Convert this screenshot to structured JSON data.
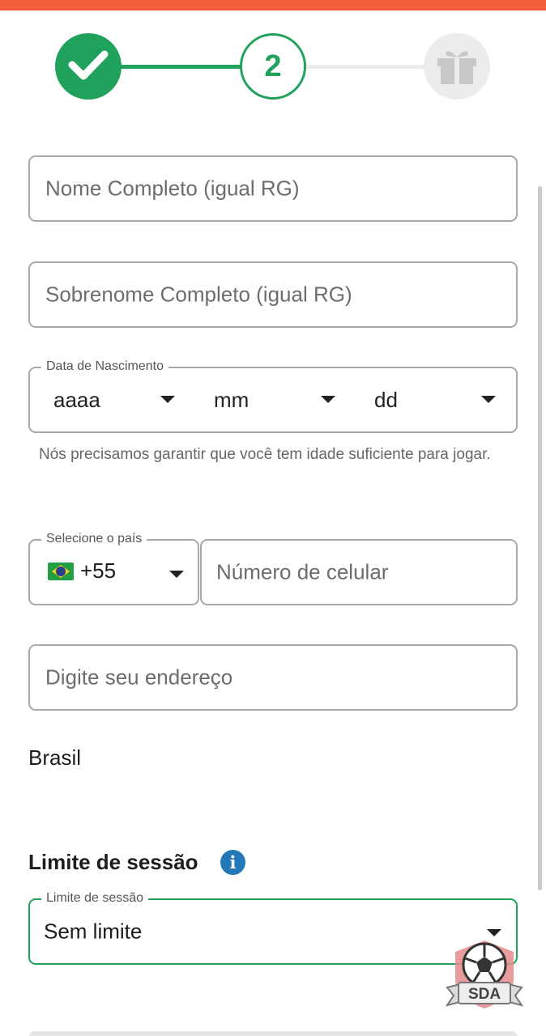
{
  "stepper": {
    "current_step": "2"
  },
  "form": {
    "first_name_placeholder": "Nome Completo (igual RG)",
    "last_name_placeholder": "Sobrenome Completo (igual RG)",
    "dob": {
      "legend": "Data de Nascimento",
      "year": "aaaa",
      "month": "mm",
      "day": "dd"
    },
    "dob_helper": "Nós precisamos garantir que você tem idade suficiente para jogar.",
    "country_code": {
      "legend": "Selecione o país",
      "value": "+55"
    },
    "phone_placeholder": "Número de celular",
    "address_placeholder": "Digite seu endereço",
    "country_name": "Brasil",
    "session_limit": {
      "section_title": "Limite de sessão",
      "legend": "Limite de sessão",
      "value": "Sem limite"
    }
  },
  "watermark": {
    "text": "SDA"
  },
  "colors": {
    "accent": "#20a25d",
    "top_bar": "#f45d3b",
    "info": "#2378b8"
  }
}
